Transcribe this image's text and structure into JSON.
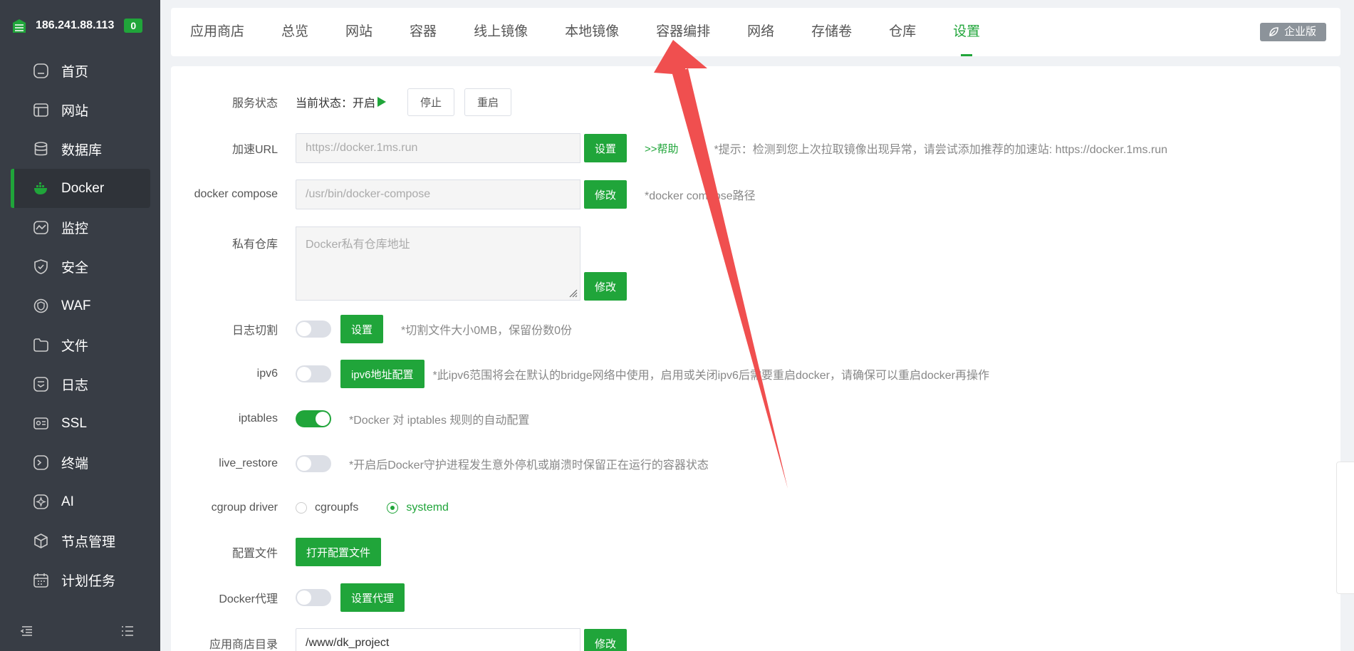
{
  "sidebar": {
    "ip": "186.241.88.113",
    "badge": "0",
    "items": [
      {
        "label": "首页",
        "icon": "home-icon"
      },
      {
        "label": "网站",
        "icon": "website-icon"
      },
      {
        "label": "数据库",
        "icon": "database-icon"
      },
      {
        "label": "Docker",
        "icon": "docker-icon",
        "active": true
      },
      {
        "label": "监控",
        "icon": "monitor-icon"
      },
      {
        "label": "安全",
        "icon": "shield-icon"
      },
      {
        "label": "WAF",
        "icon": "waf-icon"
      },
      {
        "label": "文件",
        "icon": "folder-icon"
      },
      {
        "label": "日志",
        "icon": "log-icon"
      },
      {
        "label": "SSL",
        "icon": "ssl-icon"
      },
      {
        "label": "终端",
        "icon": "terminal-icon"
      },
      {
        "label": "AI",
        "icon": "ai-icon"
      },
      {
        "label": "节点管理",
        "icon": "node-icon"
      },
      {
        "label": "计划任务",
        "icon": "calendar-icon"
      }
    ]
  },
  "tabs": [
    "应用商店",
    "总览",
    "网站",
    "容器",
    "线上镜像",
    "本地镜像",
    "容器编排",
    "网络",
    "存储卷",
    "仓库",
    "设置"
  ],
  "active_tab": "设置",
  "enterprise_label": "企业版",
  "settings": {
    "service_status": {
      "label": "服务状态",
      "current": "当前状态：开启",
      "stop_btn": "停止",
      "restart_btn": "重启"
    },
    "mirror_url": {
      "label": "加速URL",
      "placeholder": "https://docker.1ms.run",
      "btn": "设置",
      "help": ">>帮助",
      "hint": "*提示：检测到您上次拉取镜像出现异常，请尝试添加推荐的加速站: https://docker.1ms.run"
    },
    "compose": {
      "label": "docker compose",
      "placeholder": "/usr/bin/docker-compose",
      "btn": "修改",
      "hint": "*docker compose路径"
    },
    "private_repo": {
      "label": "私有仓库",
      "placeholder": "Docker私有仓库地址",
      "btn": "修改"
    },
    "log_cut": {
      "label": "日志切割",
      "enabled": false,
      "btn": "设置",
      "hint": "*切割文件大小0MB，保留份数0份"
    },
    "ipv6": {
      "label": "ipv6",
      "enabled": false,
      "btn": "ipv6地址配置",
      "hint": "*此ipv6范围将会在默认的bridge网络中使用，启用或关闭ipv6后需要重启docker，请确保可以重启docker再操作"
    },
    "iptables": {
      "label": "iptables",
      "enabled": true,
      "hint": "*Docker 对 iptables 规则的自动配置"
    },
    "live_restore": {
      "label": "live_restore",
      "enabled": false,
      "hint": "*开启后Docker守护进程发生意外停机或崩溃时保留正在运行的容器状态"
    },
    "cgroup": {
      "label": "cgroup driver",
      "options": [
        "cgroupfs",
        "systemd"
      ],
      "selected": "systemd"
    },
    "config_file": {
      "label": "配置文件",
      "btn": "打开配置文件"
    },
    "proxy": {
      "label": "Docker代理",
      "enabled": false,
      "btn": "设置代理"
    },
    "app_dir": {
      "label": "应用商店目录",
      "value": "/www/dk_project",
      "btn": "修改"
    }
  },
  "colors": {
    "accent": "#20a53a",
    "sidebar_bg": "#383d45",
    "annotation_arrow": "#f04f4f"
  }
}
